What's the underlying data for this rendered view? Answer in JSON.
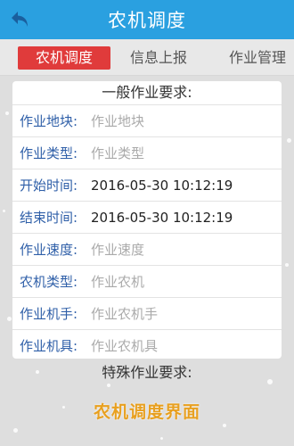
{
  "header": {
    "title": "农机调度"
  },
  "tabs": [
    {
      "label": "农机调度",
      "active": true
    },
    {
      "label": "信息上报",
      "active": false
    },
    {
      "label": "作业管理",
      "active": false
    }
  ],
  "general": {
    "title": "一般作业要求:",
    "fields": [
      {
        "label": "作业地块:",
        "placeholder": "作业地块",
        "value": ""
      },
      {
        "label": "作业类型:",
        "placeholder": "作业类型",
        "value": ""
      },
      {
        "label": "开始时间:",
        "placeholder": "",
        "value": "2016-05-30 10:12:19"
      },
      {
        "label": "结束时间:",
        "placeholder": "",
        "value": "2016-05-30 10:12:19"
      },
      {
        "label": "作业速度:",
        "placeholder": "作业速度",
        "value": ""
      },
      {
        "label": "农机类型:",
        "placeholder": "作业农机",
        "value": ""
      },
      {
        "label": "作业机手:",
        "placeholder": "作业农机手",
        "value": ""
      },
      {
        "label": "作业机具:",
        "placeholder": "作业农机具",
        "value": ""
      }
    ]
  },
  "special": {
    "title": "特殊作业要求:"
  },
  "watermark": {
    "text": "农机调度界面"
  },
  "colors": {
    "titlebar": "#2aa0e0",
    "active_tab": "#e03b3b",
    "label": "#2f5fa8",
    "watermark": "#e8a020"
  },
  "icons": {
    "back": "back-arrow-icon"
  }
}
